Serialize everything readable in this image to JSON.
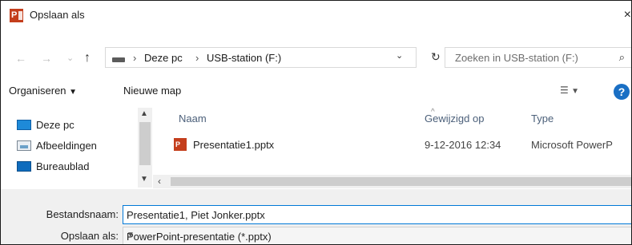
{
  "window": {
    "title": "Opslaan als",
    "app_icon": "powerpoint-icon",
    "close_glyph": "×"
  },
  "address": {
    "back": "←",
    "forward": "→",
    "history": "⌄",
    "up": "↑",
    "breadcrumb": [
      "Deze pc",
      "USB-station (F:)"
    ],
    "separator": "›",
    "dropdown": "⌄",
    "refresh": "↻"
  },
  "search": {
    "placeholder": "Zoeken in USB-station (F:)",
    "icon": "search-icon"
  },
  "toolbar": {
    "organize_label": "Organiseren",
    "new_folder_label": "Nieuwe map",
    "help": "?"
  },
  "nav_pane": {
    "items": [
      {
        "label": "Deze pc",
        "icon": "computer-icon"
      },
      {
        "label": "Afbeeldingen",
        "icon": "pictures-icon"
      },
      {
        "label": "Bureaublad",
        "icon": "desktop-icon"
      }
    ]
  },
  "file_list": {
    "columns": [
      "Naam",
      "Gewijzigd op",
      "Type"
    ],
    "rows": [
      {
        "name": "Presentatie1.pptx",
        "modified": "9-12-2016 12:34",
        "type": "Microsoft PowerP"
      }
    ]
  },
  "form": {
    "filename_label": "Bestandsnaam:",
    "filename_value": "Presentatie1, Piet Jonker.pptx",
    "filetype_label": "Opslaan als:",
    "filetype_value": "PowerPoint-presentatie (*.pptx)"
  },
  "colors": {
    "powerpoint": "#c43e1c",
    "accent": "#0078d7",
    "help": "#1a6fc4"
  }
}
